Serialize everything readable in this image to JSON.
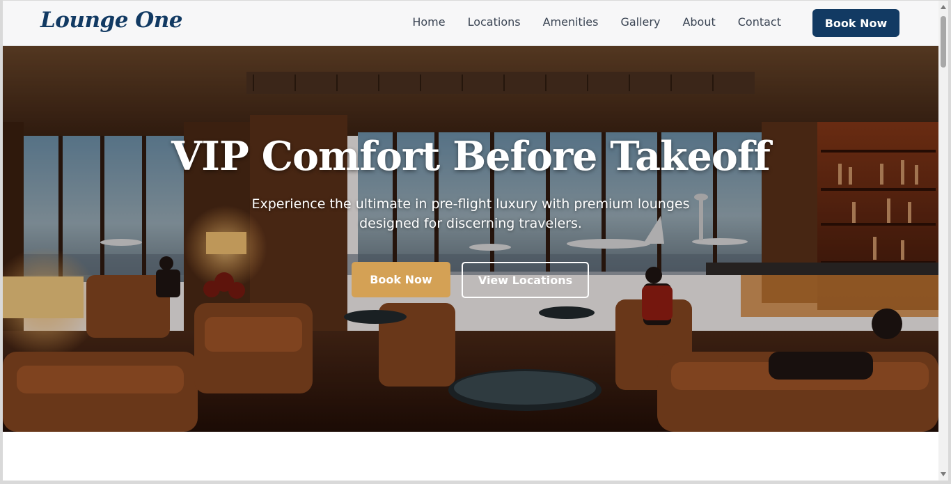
{
  "brand": {
    "logo": "Lounge One"
  },
  "nav": {
    "links": [
      "Home",
      "Locations",
      "Amenities",
      "Gallery",
      "About",
      "Contact"
    ],
    "cta": "Book Now"
  },
  "hero": {
    "title": "VIP Comfort Before Takeoff",
    "subtitle": "Experience the ultimate in pre-flight luxury with premium lounges designed for discerning travelers.",
    "primary_button": "Book Now",
    "secondary_button": "View Locations"
  },
  "colors": {
    "brand_navy": "#123a63",
    "accent_gold": "#d4a155"
  }
}
